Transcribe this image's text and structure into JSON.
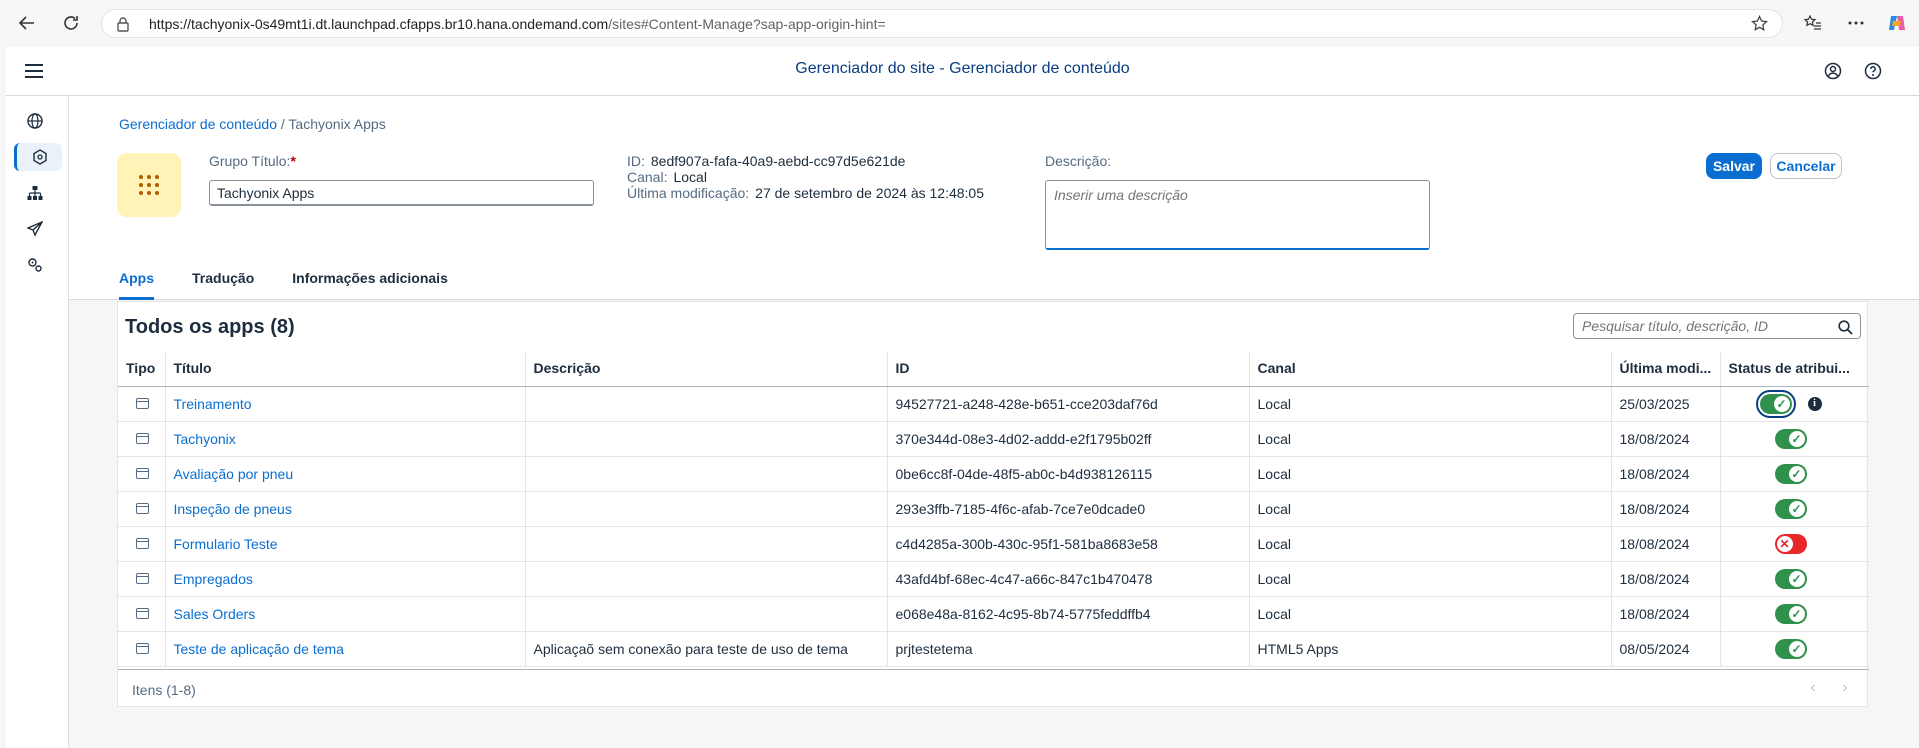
{
  "browser": {
    "url_host": "https://tachyonix-0s49mt1i.dt.launchpad.cfapps.br10.hana.ondemand.com",
    "url_path": "/sites#Content-Manage?sap-app-origin-hint="
  },
  "shell": {
    "title": "Gerenciador do site - Gerenciador de conteúdo"
  },
  "breadcrumb": {
    "link": "Gerenciador de conteúdo",
    "separator": "/",
    "current": "Tachyonix Apps"
  },
  "form": {
    "group_title_label": "Grupo Título:",
    "required_mark": "*",
    "group_title_value": "Tachyonix Apps",
    "id_label": "ID:",
    "id_value": "8edf907a-fafa-40a9-aebd-cc97d5e621de",
    "canal_label": "Canal:",
    "canal_value": "Local",
    "modified_label": "Última modificação:",
    "modified_value": "27 de setembro de 2024 às 12:48:05",
    "description_label": "Descrição:",
    "description_placeholder": "Inserir uma descrição",
    "save_label": "Salvar",
    "cancel_label": "Cancelar"
  },
  "tabs": [
    {
      "label": "Apps",
      "active": true
    },
    {
      "label": "Tradução",
      "active": false
    },
    {
      "label": "Informações adicionais",
      "active": false
    }
  ],
  "list": {
    "title": "Todos os apps (8)",
    "search_placeholder": "Pesquisar título, descrição, ID",
    "columns": [
      "Tipo",
      "Título",
      "Descrição",
      "ID",
      "Canal",
      "Última modi...",
      "Status de atribui..."
    ],
    "rows": [
      {
        "title": "Treinamento",
        "description": "",
        "id": "94527721-a248-428e-b651-cce203daf76d",
        "canal": "Local",
        "date": "25/03/2025",
        "status": "on"
      },
      {
        "title": "Tachyonix",
        "description": "",
        "id": "370e344d-08e3-4d02-addd-e2f1795b02ff",
        "canal": "Local",
        "date": "18/08/2024",
        "status": "on"
      },
      {
        "title": "Avaliação por pneu",
        "description": "",
        "id": "0be6cc8f-04de-48f5-ab0c-b4d938126115",
        "canal": "Local",
        "date": "18/08/2024",
        "status": "on"
      },
      {
        "title": "Inspeção de pneus",
        "description": "",
        "id": "293e3ffb-7185-4f6c-afab-7ce7e0dcade0",
        "canal": "Local",
        "date": "18/08/2024",
        "status": "on"
      },
      {
        "title": "Formulario Teste",
        "description": "",
        "id": "c4d4285a-300b-430c-95f1-581ba8683e58",
        "canal": "Local",
        "date": "18/08/2024",
        "status": "off"
      },
      {
        "title": "Empregados",
        "description": "",
        "id": "43afd4bf-68ec-4c47-a66c-847c1b470478",
        "canal": "Local",
        "date": "18/08/2024",
        "status": "on"
      },
      {
        "title": "Sales Orders",
        "description": "",
        "id": "e068e48a-8162-4c95-8b74-5775feddffb4",
        "canal": "Local",
        "date": "18/08/2024",
        "status": "on"
      },
      {
        "title": "Teste de aplicação de tema",
        "description": "Aplicaçaõ sem conexão para teste de uso de tema",
        "id": "prjtestetema",
        "canal": "HTML5 Apps",
        "date": "08/05/2024",
        "status": "on"
      }
    ],
    "items_count": "Itens (1-8)"
  }
}
